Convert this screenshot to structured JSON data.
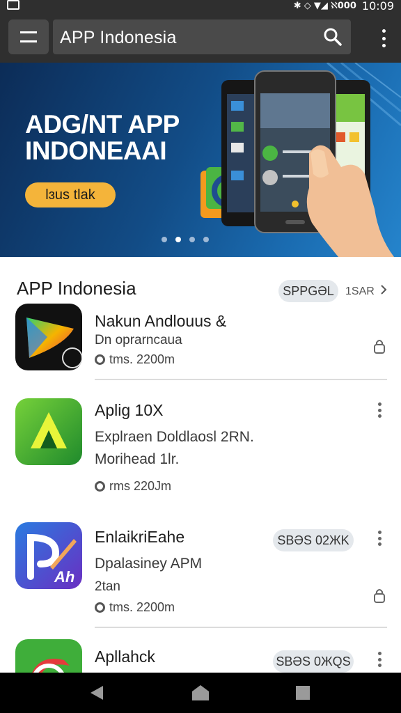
{
  "status_bar": {
    "indicators": "✱ ◇ ▼◢ ℵ𝟬𝟬𝟬",
    "time": "10:09"
  },
  "search": {
    "value": "APP  Indonesia"
  },
  "banner": {
    "title_line1": "ADG/NT APP",
    "title_line2": "INDONEAAI",
    "button_label": "lɜus tlak",
    "page_count": 4,
    "active_page": 2
  },
  "section": {
    "title": "APP Indonesia",
    "chip_label": "SPPGƏL",
    "more_label": "1SAR"
  },
  "apps": [
    {
      "title": "Nakun Andlouus &",
      "subtitle_line1": "Dn oprarncaua",
      "subtitle_line2": "",
      "meta": "tms. 2200m",
      "chip": "",
      "icon": "play-style-app-icon",
      "action": "lock-icon"
    },
    {
      "title": "Aplig 10X",
      "subtitle_line1": "Explraen Doldlaosl 2RN.",
      "subtitle_line2": "Morihead 1lr.",
      "meta": "rms 220Jm",
      "chip": "",
      "icon": "green-a-app-icon",
      "action": "kebab-menu-icon"
    },
    {
      "title": "EnlaikriEahe",
      "subtitle_line1": "Dpalasiney APM",
      "subtitle_line2": "2tan",
      "meta": "tms. 2200m",
      "chip": "SBƏS 02ЖK",
      "icon": "blue-pen-app-icon",
      "action": "lock-icon"
    },
    {
      "title": "Apllahck",
      "subtitle_line1": "",
      "subtitle_line2": "",
      "meta": "",
      "chip": "SBƏS 0ЖQS",
      "icon": "red-swirl-app-icon",
      "action": "kebab-menu-icon"
    }
  ],
  "colors": {
    "app_bar": "#2f2f2f",
    "banner_button": "#f4b43a",
    "chip_background": "#e4e8ec",
    "nav_bar": "#000000"
  }
}
